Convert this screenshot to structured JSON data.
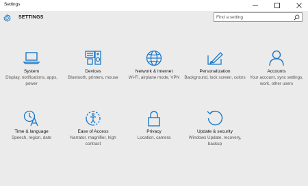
{
  "window": {
    "title": "Settings"
  },
  "header": {
    "title": "SETTINGS"
  },
  "search": {
    "placeholder": "Find a setting"
  },
  "accent_color": "#1979ca",
  "tiles": [
    {
      "label": "System",
      "description": "Display, notifications, apps, power",
      "icon": "laptop-icon"
    },
    {
      "label": "Devices",
      "description": "Bluetooth, printers, mouse",
      "icon": "devices-icon"
    },
    {
      "label": "Network & Internet",
      "description": "Wi-Fi, airplane mode, VPN",
      "icon": "globe-icon"
    },
    {
      "label": "Personalization",
      "description": "Background, lock screen, colors",
      "icon": "personalization-icon"
    },
    {
      "label": "Accounts",
      "description": "Your account, sync settings, work, other users",
      "icon": "person-icon"
    },
    {
      "label": "Time & language",
      "description": "Speech, region, date",
      "icon": "time-language-icon"
    },
    {
      "label": "Ease of Access",
      "description": "Narrator, magnifier, high contrast",
      "icon": "ease-of-access-icon"
    },
    {
      "label": "Privacy",
      "description": "Location, camera",
      "icon": "lock-icon"
    },
    {
      "label": "Update & security",
      "description": "Windows Update, recovery, backup",
      "icon": "update-icon"
    }
  ]
}
